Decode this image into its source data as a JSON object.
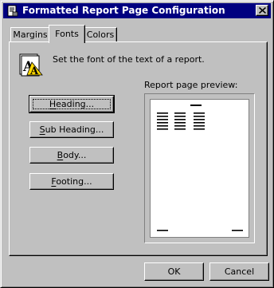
{
  "window": {
    "title": "Formatted Report Page Configuration",
    "icon": "report-config-icon"
  },
  "tabs": [
    {
      "label": "Margins",
      "active": false
    },
    {
      "label": "Fonts",
      "active": true
    },
    {
      "label": "Colors",
      "active": false
    }
  ],
  "fonts_panel": {
    "icon": "fonts-aa-icon",
    "description": "Set the font of the text of a report.",
    "buttons": {
      "heading": {
        "mnemonic": "H",
        "rest": "eading..."
      },
      "sub_heading": {
        "mnemonic": "S",
        "rest": "ub Heading..."
      },
      "body": {
        "mnemonic": "B",
        "rest": "ody..."
      },
      "footing": {
        "mnemonic": "F",
        "rest": "ooting..."
      }
    },
    "preview_label": "Report page preview:"
  },
  "footer": {
    "ok_label": "OK",
    "cancel_label": "Cancel"
  },
  "colors": {
    "titlebar": "#000080",
    "face": "#c0c0c0",
    "highlight": "#ffffff",
    "shadow": "#808080",
    "icon_yellow": "#ffd800"
  }
}
